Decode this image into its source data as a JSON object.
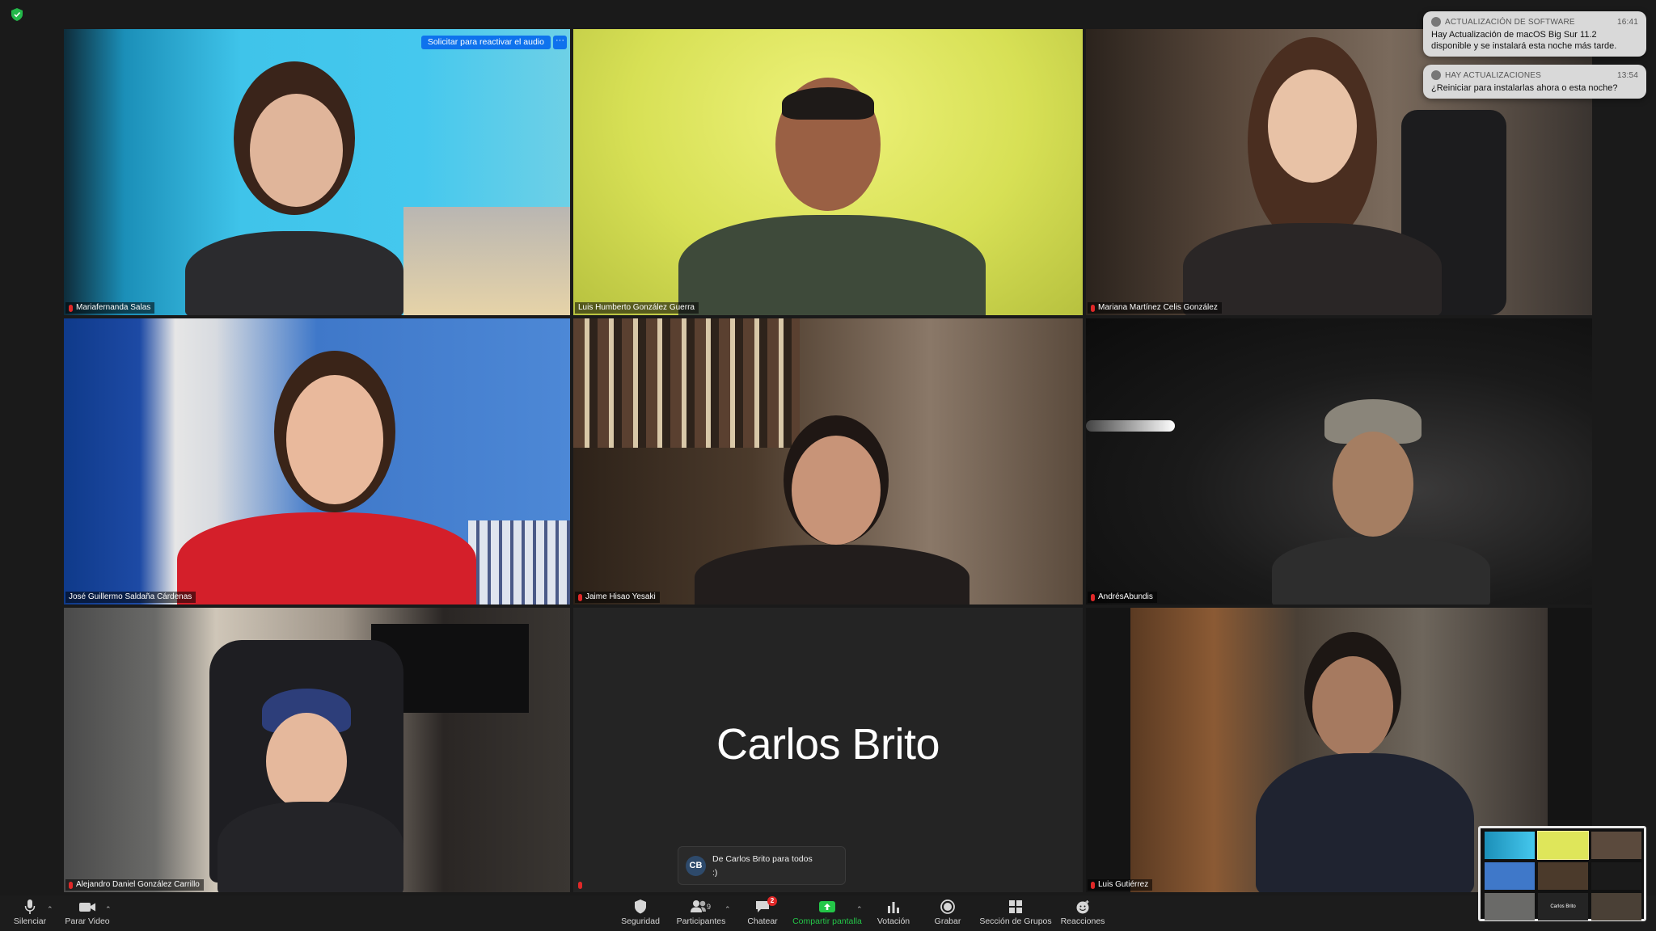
{
  "colors": {
    "accent_blue": "#0e72ed",
    "active_speaker": "#f7f29a",
    "share_green": "#24c648",
    "muted_red": "#e02828"
  },
  "meeting": {
    "participants": [
      {
        "name": "Mariafernanda Salas",
        "muted": true
      },
      {
        "name": "Luis Humberto González Guerra",
        "muted": false,
        "active_speaker": true
      },
      {
        "name": "Mariana Martínez Celis González",
        "muted": true
      },
      {
        "name": "José Guillermo Saldaña Cárdenas",
        "muted": false
      },
      {
        "name": "Jaime Hisao Yesaki",
        "muted": true
      },
      {
        "name": "AndrésAbundis",
        "muted": true
      },
      {
        "name": "Alejandro Daniel González Carrillo",
        "muted": true
      },
      {
        "name": "Carlos Brito",
        "muted": true,
        "video_off": true
      },
      {
        "name": "Luis Gutiérrez",
        "muted": true
      }
    ],
    "request_unmute_label": "Solicitar para reactivar el audio",
    "more_label": "···"
  },
  "notifications": [
    {
      "app": "ACTUALIZACIÓN DE SOFTWARE",
      "time": "16:41",
      "body": "Hay Actualización de macOS Big Sur 11.2 disponible y se instalará esta noche más tarde."
    },
    {
      "app": "HAY ACTUALIZACIONES",
      "time": "13:54",
      "body": "¿Reiniciar para instalarlas ahora o esta noche?"
    }
  ],
  "chat_popup": {
    "avatar_initials": "CB",
    "from": "De Carlos Brito para todos",
    "message": ":)"
  },
  "toolbar": {
    "mute": {
      "label": "Silenciar",
      "icon": "microphone-icon"
    },
    "video": {
      "label": "Parar Video",
      "icon": "video-camera-icon"
    },
    "security": {
      "label": "Seguridad",
      "icon": "shield-icon"
    },
    "participants": {
      "label": "Participantes",
      "count": "9",
      "icon": "people-icon"
    },
    "chat": {
      "label": "Chatear",
      "badge": "2",
      "icon": "chat-bubble-icon"
    },
    "share": {
      "label": "Compartir pantalla",
      "icon": "share-screen-icon"
    },
    "poll": {
      "label": "Votación",
      "icon": "bar-chart-icon"
    },
    "record": {
      "label": "Grabar",
      "icon": "record-icon"
    },
    "breakout": {
      "label": "Sección de Grupos",
      "icon": "grid-icon"
    },
    "reactions": {
      "label": "Reacciones",
      "icon": "smiley-icon"
    }
  },
  "mini_view": {
    "center_name": "Carlos Brito"
  }
}
